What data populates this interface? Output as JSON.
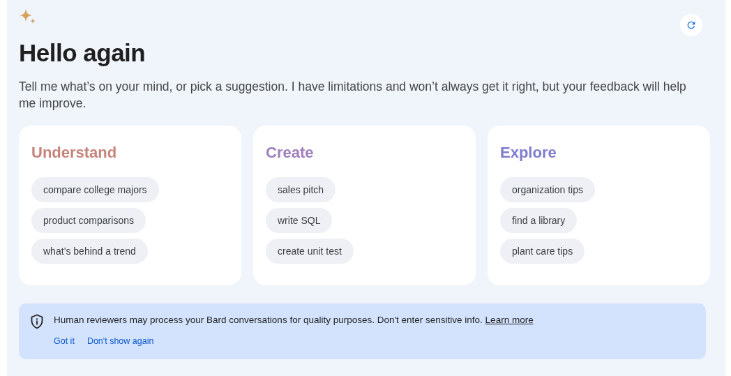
{
  "greeting": {
    "title": "Hello again",
    "subtitle": "Tell me what’s on your mind, or pick a suggestion. I have limitations and won’t always get it right, but your feedback will help me improve."
  },
  "cards": [
    {
      "title": "Understand",
      "color": "#c5837a",
      "suggestions": [
        "compare college majors",
        "product comparisons",
        "what’s behind a trend"
      ]
    },
    {
      "title": "Create",
      "color": "#a07dbd",
      "suggestions": [
        "sales pitch",
        "write SQL",
        "create unit test"
      ]
    },
    {
      "title": "Explore",
      "color": "#7f7ccf",
      "suggestions": [
        "organization tips",
        "find a library",
        "plant care tips"
      ]
    }
  ],
  "notice": {
    "text": "Human reviewers may process your Bard conversations for quality purposes. Don't enter sensitive info.",
    "link": "Learn more",
    "actions": [
      "Got it",
      "Don't show again"
    ]
  }
}
